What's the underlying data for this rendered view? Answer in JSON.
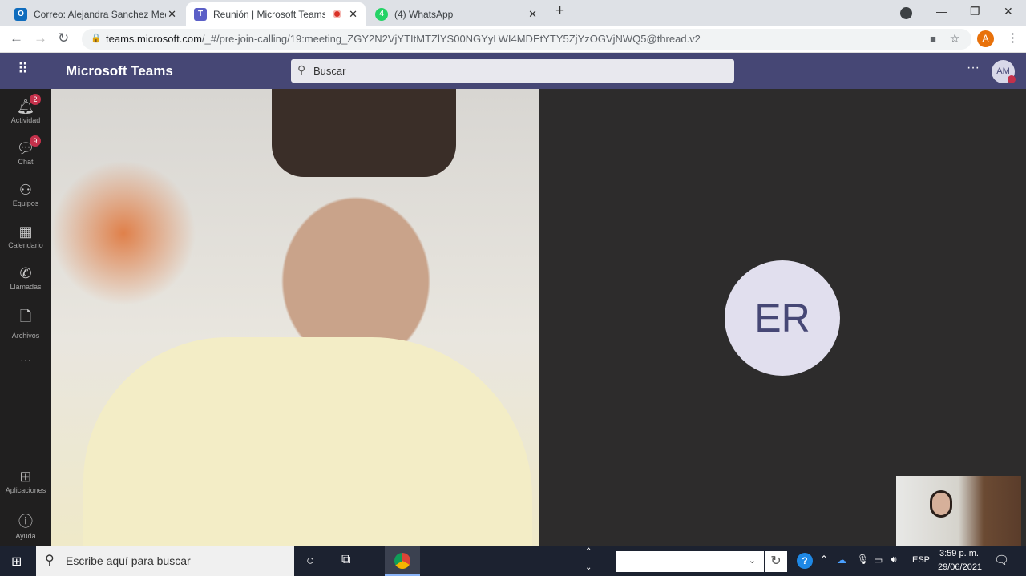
{
  "browser": {
    "tabs": [
      {
        "title": "Correo: Alejandra Sanchez Medina",
        "icon": "outlook-icon",
        "active": false
      },
      {
        "title": "Reunión | Microsoft Teams",
        "icon": "teams-icon",
        "active": true,
        "recording": true
      },
      {
        "title": "(4) WhatsApp",
        "icon": "whatsapp-icon",
        "active": false
      }
    ],
    "url_host": "teams.microsoft.com",
    "url_path": "/_#/pre-join-calling/19:meeting_ZGY2N2VjYTItMTZlYS00NGYyLWI4MDEtYTY5ZjYzOGVjNWQ5@thread.v2",
    "profile_initial": "A",
    "profile_color": "#e8710a"
  },
  "teams": {
    "app_title": "Microsoft Teams",
    "search_placeholder": "Buscar",
    "avatar": "AM",
    "brand_color": "#464775",
    "rail": [
      {
        "label": "Actividad",
        "icon": "bell-icon",
        "badge": "2"
      },
      {
        "label": "Chat",
        "icon": "chat-icon",
        "badge": "9"
      },
      {
        "label": "Equipos",
        "icon": "teams-icon",
        "badge": null
      },
      {
        "label": "Calendario",
        "icon": "calendar-icon",
        "badge": null
      },
      {
        "label": "Llamadas",
        "icon": "phone-icon",
        "badge": null
      },
      {
        "label": "Archivos",
        "icon": "file-icon",
        "badge": null
      }
    ],
    "rail_bottom": [
      {
        "label": "Aplicaciones",
        "icon": "apps-icon"
      },
      {
        "label": "Ayuda",
        "icon": "help-icon"
      }
    ],
    "participant_initials": "ER"
  },
  "taskbar": {
    "search_placeholder": "Escribe aquí para buscar",
    "language": "ESP",
    "time": "3:59 p. m.",
    "date": "29/06/2021"
  }
}
